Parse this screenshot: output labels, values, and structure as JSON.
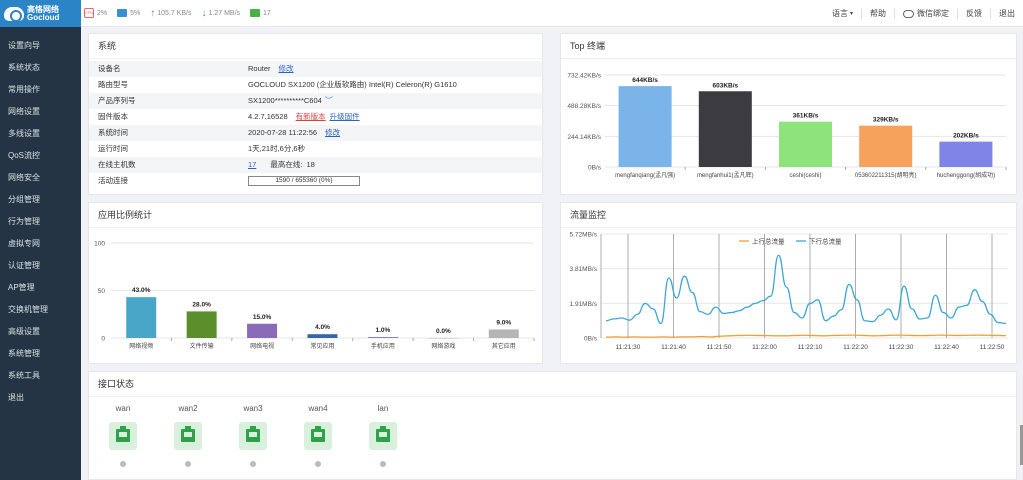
{
  "brand": {
    "name_cn": "高恪网络",
    "name_en": "Gocloud"
  },
  "sidebar": {
    "items": [
      {
        "label": "设置向导"
      },
      {
        "label": "系统状态"
      },
      {
        "label": "常用操作"
      },
      {
        "label": "网络设置"
      },
      {
        "label": "多线设置"
      },
      {
        "label": "QoS流控"
      },
      {
        "label": "网络安全"
      },
      {
        "label": "分组管理"
      },
      {
        "label": "行为管理"
      },
      {
        "label": "虚拟专网"
      },
      {
        "label": "认证管理"
      },
      {
        "label": "AP管理"
      },
      {
        "label": "交换机管理"
      },
      {
        "label": "高级设置"
      },
      {
        "label": "系统管理"
      },
      {
        "label": "系统工具"
      },
      {
        "label": "退出"
      }
    ]
  },
  "topbar": {
    "cpu": "2%",
    "mem": "5%",
    "upload": "105.7 KB/s",
    "download": "1.27 MB/s",
    "devices": "17",
    "cpu_icon": "cpu-icon",
    "mem_icon": "memory-icon",
    "right": {
      "language": "语言",
      "help": "帮助",
      "wechat": "微信绑定",
      "feedback": "反馈",
      "logout": "退出"
    }
  },
  "system": {
    "title": "系统",
    "rows": [
      {
        "key": "设备名",
        "value": "Router",
        "link": "修改"
      },
      {
        "key": "路由型号",
        "value": "GOCLOUD SX1200 (企业版软路由) Intel(R) Celeron(R) G1610"
      },
      {
        "key": "产品序列号",
        "value": "SX1200**********C604"
      },
      {
        "key": "固件版本",
        "value": "4.2.7.16528",
        "link_red": "有新版本",
        "link2": "升级固件"
      },
      {
        "key": "系统时间",
        "value": "2020-07-28 11:22:56",
        "link": "修改"
      },
      {
        "key": "运行时间",
        "value": "1天,21时,6分,6秒"
      },
      {
        "key": "在线主机数",
        "value": "17",
        "extra_label": "最高在线:",
        "extra_value": "18"
      },
      {
        "key": "活动连接",
        "value": "1590 / 655360 (0%)"
      }
    ]
  },
  "top": {
    "title": "Top 终端",
    "chart_data": {
      "type": "bar",
      "categories": [
        "mengfanqiang(孟凡强)",
        "mengfanhui1(孟凡辉)",
        "ceshi(ceshi)",
        "053602211315(胡明亮)",
        "huchenggong(胡成功)"
      ],
      "values": [
        644,
        603,
        361,
        329,
        202
      ],
      "labels": [
        "644KB/s",
        "603KB/s",
        "361KB/s",
        "329KB/s",
        "202KB/s"
      ],
      "colors": [
        "#7ab4e8",
        "#3b3b40",
        "#8ee37a",
        "#f6a25c",
        "#7f84e6"
      ],
      "y_ticks": [
        "732.42KB/s",
        "488.28KB/s",
        "244.14KB/s",
        "0B/s"
      ],
      "ylim": [
        0,
        732.42
      ]
    }
  },
  "app": {
    "title": "应用比例统计",
    "chart_data": {
      "type": "bar",
      "categories": [
        "网络视频",
        "文件传输",
        "网络电视",
        "常见应用",
        "手机应用",
        "网络游戏",
        "其它应用"
      ],
      "values": [
        43.0,
        28.0,
        15.0,
        4.0,
        1.0,
        0.0,
        9.0
      ],
      "labels": [
        "43.0%",
        "28.0%",
        "15.0%",
        "4.0%",
        "1.0%",
        "0.0%",
        "9.0%"
      ],
      "colors": [
        "#4aa6c9",
        "#5a8f2c",
        "#8a6bb8",
        "#3567a8",
        "#7a87a8",
        "#b0b0b0",
        "#b5b5b5"
      ],
      "y_ticks": [
        "100",
        "50",
        "0"
      ],
      "ylim": [
        0,
        100
      ]
    }
  },
  "traffic": {
    "title": "流量监控",
    "chart_data": {
      "type": "line",
      "y_ticks": [
        "5.72MB/s",
        "3.81MB/s",
        "1.91MB/s",
        "0B/s"
      ],
      "ylim": [
        0,
        5.72
      ],
      "x_ticks": [
        "11:21:30",
        "11:21:40",
        "11:21:50",
        "11:22:00",
        "11:22:10",
        "11:22:20",
        "11:22:30",
        "11:22:40",
        "11:22:50"
      ],
      "series": [
        {
          "name": "上行总流量",
          "color": "#f0a030",
          "values": [
            0.05,
            0.06,
            0.05,
            0.06,
            0.05,
            0.05,
            0.06,
            0.05,
            0.06,
            0.06,
            0.08,
            0.06,
            0.1,
            0.12,
            0.14,
            0.15,
            0.14,
            0.13,
            0.12,
            0.12,
            0.14,
            0.15,
            0.13,
            0.12,
            0.14,
            0.15,
            0.16,
            0.14,
            0.12,
            0.13,
            0.15,
            0.16,
            0.14,
            0.13,
            0.14,
            0.16,
            0.15,
            0.14,
            0.15,
            0.16,
            0.15,
            0.14,
            0.13
          ]
        },
        {
          "name": "下行总流量",
          "color": "#3fa7d8",
          "values": [
            0.95,
            1.05,
            1.1,
            0.98,
            1.3,
            1.9,
            1.6,
            0.8,
            3.3,
            2.2,
            3.4,
            2.5,
            1.45,
            1.3,
            1.7,
            1.35,
            1.4,
            1.5,
            1.7,
            1.9,
            2.05,
            2.3,
            4.55,
            2.8,
            1.4,
            1.1,
            1.9,
            2.1,
            0.95,
            1.2,
            1.55,
            2.95,
            2.1,
            0.95,
            0.9,
            1.25,
            1.6,
            1.0,
            2.85,
            1.6,
            1.05,
            1.1,
            2.35,
            1.4,
            1.1,
            1.7,
            1.8,
            2.65,
            2.0,
            1.3,
            0.85,
            0.8
          ]
        }
      ]
    }
  },
  "ports": {
    "title": "接口状态",
    "items": [
      {
        "name": "wan"
      },
      {
        "name": "wan2"
      },
      {
        "name": "wan3"
      },
      {
        "name": "wan4"
      },
      {
        "name": "lan"
      }
    ]
  }
}
